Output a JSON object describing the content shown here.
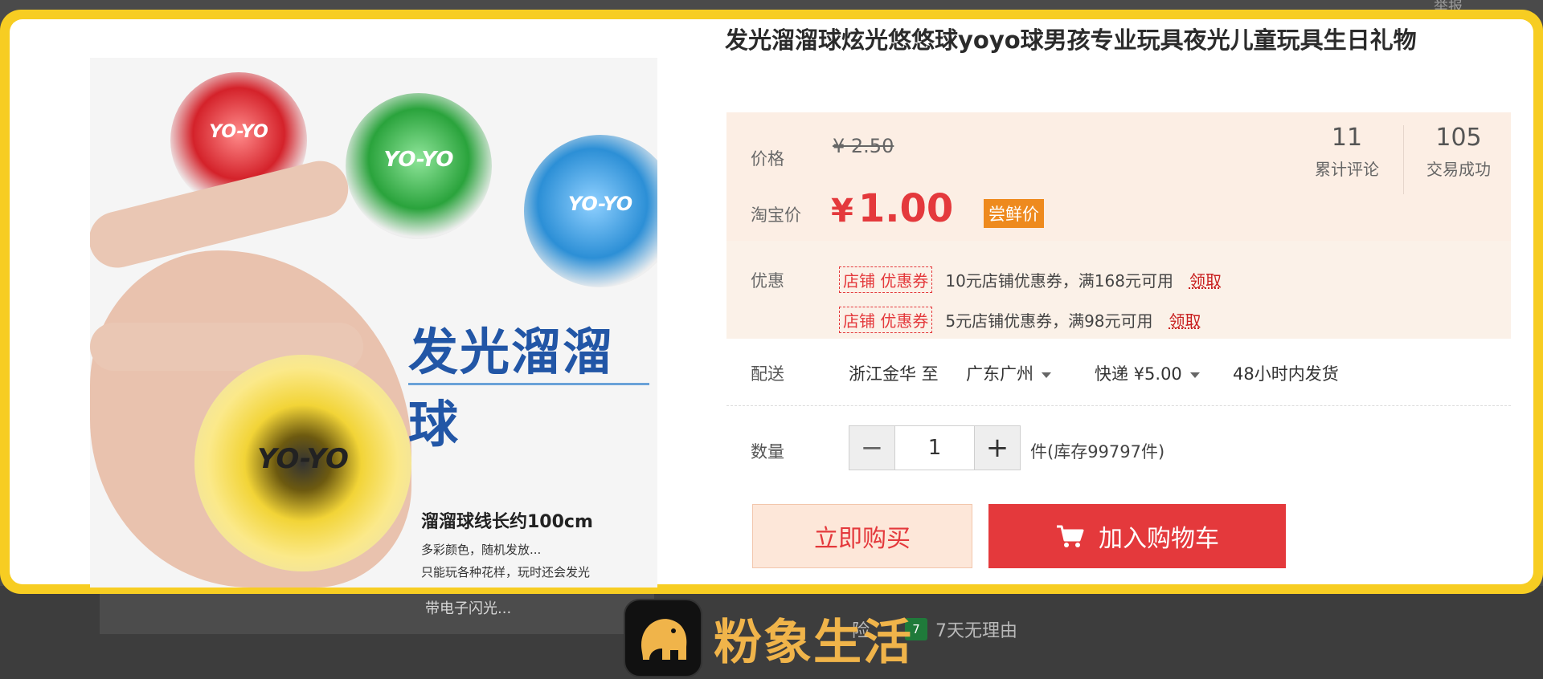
{
  "backdrop": {
    "top_right_text": "举报"
  },
  "product": {
    "title": "发光溜溜球炫光悠悠球yoyo球男孩专业玩具夜光儿童玩具生日礼物",
    "image": {
      "headline": "发光溜溜球",
      "spec_line": "溜溜球线长约100cm",
      "note_1": "多彩颜色，随机发放...",
      "note_2": "只能玩各种花样，玩时还会发光",
      "note_3": "带电子闪光...",
      "yoyo_labels": [
        "YO-YO",
        "YO-YO",
        "YO-YO",
        "YO-YO"
      ]
    }
  },
  "price": {
    "label": "价格",
    "original": "¥ 2.50",
    "taobao_label": "淘宝价",
    "currency": "¥",
    "current": "1.00",
    "tag": "尝鲜价"
  },
  "stats": [
    {
      "number": "11",
      "label": "累计评论"
    },
    {
      "number": "105",
      "label": "交易成功"
    }
  ],
  "promotions": {
    "label": "优惠",
    "coupons": [
      {
        "tag": "店铺 优惠券",
        "text": "10元店铺优惠券，满168元可用",
        "action": "领取"
      },
      {
        "tag": "店铺 优惠券",
        "text": "5元店铺优惠券，满98元可用",
        "action": "领取"
      }
    ]
  },
  "delivery": {
    "label": "配送",
    "from": "浙江金华 至",
    "to": "广东广州",
    "method": "快递 ¥5.00",
    "dispatch": "48小时内发货"
  },
  "quantity": {
    "label": "数量",
    "minus": "−",
    "value": "1",
    "plus": "+",
    "stock": "件(库存99797件)"
  },
  "actions": {
    "buy_now": "立即购买",
    "add_to_cart": "加入购物车"
  },
  "services": {
    "insurance_tail": "险",
    "return_badge": "7",
    "return_text": "7天无理由"
  },
  "watermark": {
    "brand": "粉象生活"
  },
  "colors": {
    "accent": "#e4393c",
    "frame": "#f7cd22",
    "trial_tag": "#ee8a1e",
    "brand_text": "#f0b44a"
  }
}
